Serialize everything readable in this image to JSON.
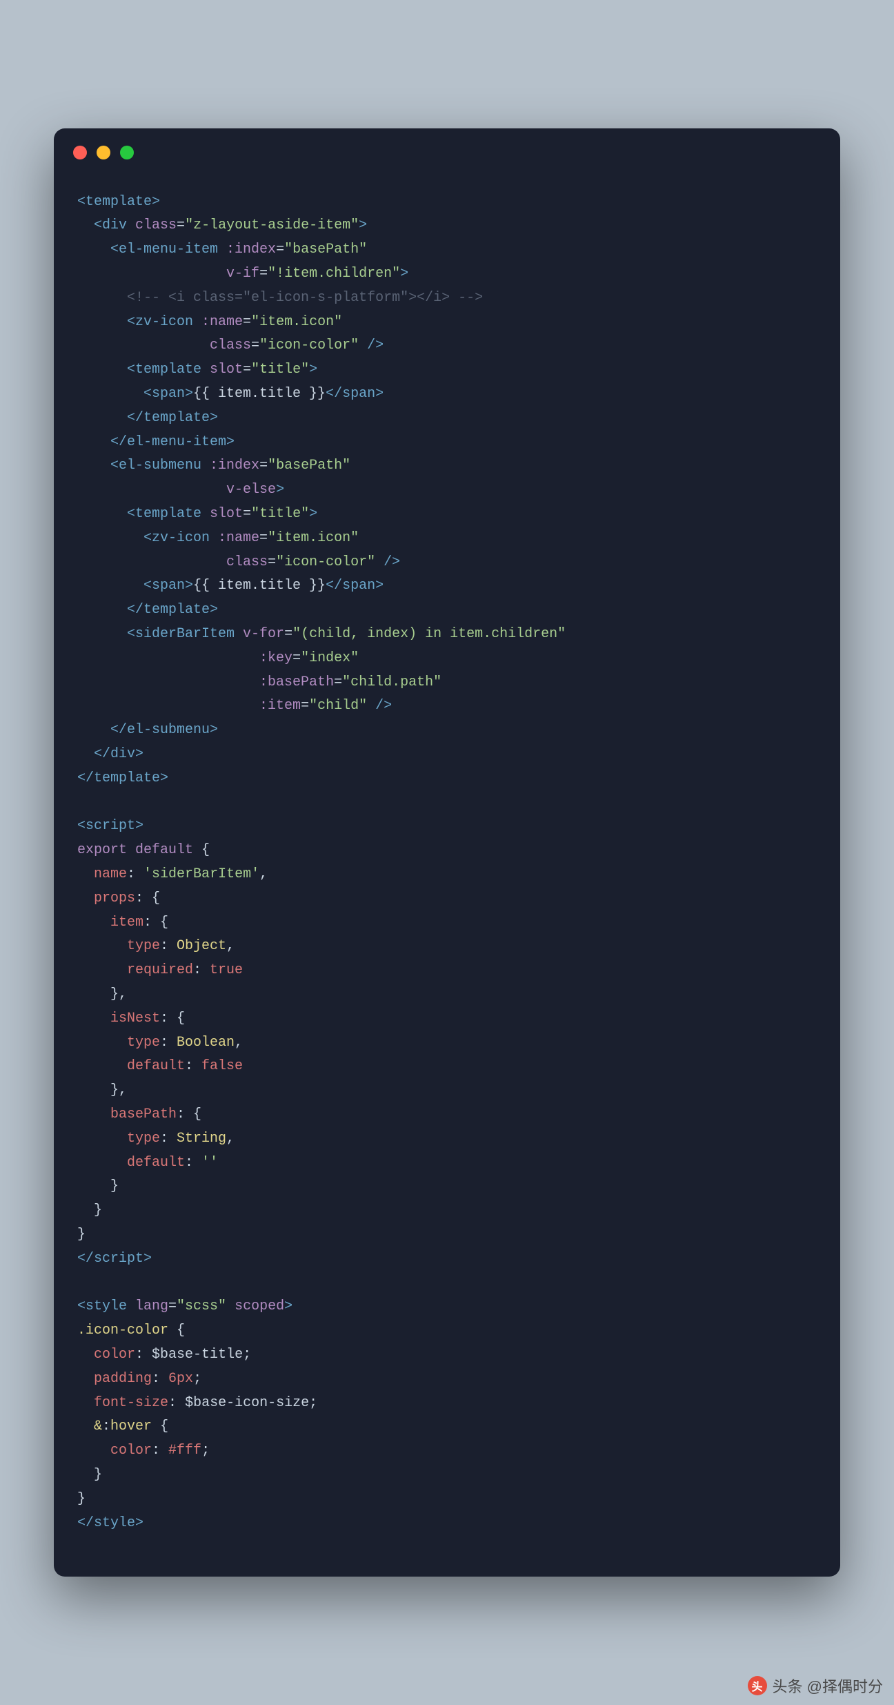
{
  "code": {
    "lines": [
      {
        "indent": 0,
        "tokens": [
          {
            "c": "tag",
            "t": "<template>"
          }
        ]
      },
      {
        "indent": 1,
        "tokens": [
          {
            "c": "tag",
            "t": "<div"
          },
          {
            "c": "attr",
            "t": " class"
          },
          {
            "c": "punct",
            "t": "="
          },
          {
            "c": "str",
            "t": "\"z-layout-aside-item\""
          },
          {
            "c": "tag",
            "t": ">"
          }
        ]
      },
      {
        "indent": 2,
        "tokens": [
          {
            "c": "tag",
            "t": "<el-menu-item"
          },
          {
            "c": "attr",
            "t": " :index"
          },
          {
            "c": "punct",
            "t": "="
          },
          {
            "c": "str",
            "t": "\"basePath\""
          }
        ]
      },
      {
        "indent": 9,
        "tokens": [
          {
            "c": "attr",
            "t": "v-if"
          },
          {
            "c": "punct",
            "t": "="
          },
          {
            "c": "str",
            "t": "\"!item.children\""
          },
          {
            "c": "tag",
            "t": ">"
          }
        ]
      },
      {
        "indent": 3,
        "tokens": [
          {
            "c": "comment",
            "t": "<!-- <i class=\"el-icon-s-platform\"></i> -->"
          }
        ]
      },
      {
        "indent": 3,
        "tokens": [
          {
            "c": "tag",
            "t": "<zv-icon"
          },
          {
            "c": "attr",
            "t": " :name"
          },
          {
            "c": "punct",
            "t": "="
          },
          {
            "c": "str",
            "t": "\"item.icon\""
          }
        ]
      },
      {
        "indent": 7,
        "align": true,
        "tokens": [
          {
            "c": "attr",
            "t": "class"
          },
          {
            "c": "punct",
            "t": "="
          },
          {
            "c": "str",
            "t": "\"icon-color\""
          },
          {
            "c": "tag",
            "t": " />"
          }
        ]
      },
      {
        "indent": 3,
        "tokens": [
          {
            "c": "tag",
            "t": "<template"
          },
          {
            "c": "attr",
            "t": " slot"
          },
          {
            "c": "punct",
            "t": "="
          },
          {
            "c": "str",
            "t": "\"title\""
          },
          {
            "c": "tag",
            "t": ">"
          }
        ]
      },
      {
        "indent": 4,
        "tokens": [
          {
            "c": "tag",
            "t": "<span>"
          },
          {
            "c": "punct",
            "t": "{{ item.title }}"
          },
          {
            "c": "tag",
            "t": "</span>"
          }
        ]
      },
      {
        "indent": 3,
        "tokens": [
          {
            "c": "tag",
            "t": "</template>"
          }
        ]
      },
      {
        "indent": 2,
        "tokens": [
          {
            "c": "tag",
            "t": "</el-menu-item>"
          }
        ]
      },
      {
        "indent": 2,
        "tokens": [
          {
            "c": "tag",
            "t": "<el-submenu"
          },
          {
            "c": "attr",
            "t": " :index"
          },
          {
            "c": "punct",
            "t": "="
          },
          {
            "c": "str",
            "t": "\"basePath\""
          }
        ]
      },
      {
        "indent": 8,
        "align": true,
        "tokens": [
          {
            "c": "attr",
            "t": "v-else"
          },
          {
            "c": "tag",
            "t": ">"
          }
        ]
      },
      {
        "indent": 3,
        "tokens": [
          {
            "c": "tag",
            "t": "<template"
          },
          {
            "c": "attr",
            "t": " slot"
          },
          {
            "c": "punct",
            "t": "="
          },
          {
            "c": "str",
            "t": "\"title\""
          },
          {
            "c": "tag",
            "t": ">"
          }
        ]
      },
      {
        "indent": 4,
        "tokens": [
          {
            "c": "tag",
            "t": "<zv-icon"
          },
          {
            "c": "attr",
            "t": " :name"
          },
          {
            "c": "punct",
            "t": "="
          },
          {
            "c": "str",
            "t": "\"item.icon\""
          }
        ]
      },
      {
        "indent": 8,
        "align": true,
        "tokens": [
          {
            "c": "attr",
            "t": "class"
          },
          {
            "c": "punct",
            "t": "="
          },
          {
            "c": "str",
            "t": "\"icon-color\""
          },
          {
            "c": "tag",
            "t": " />"
          }
        ]
      },
      {
        "indent": 4,
        "tokens": [
          {
            "c": "tag",
            "t": "<span>"
          },
          {
            "c": "punct",
            "t": "{{ item.title }}"
          },
          {
            "c": "tag",
            "t": "</span>"
          }
        ]
      },
      {
        "indent": 3,
        "tokens": [
          {
            "c": "tag",
            "t": "</template>"
          }
        ]
      },
      {
        "indent": 3,
        "tokens": [
          {
            "c": "tag",
            "t": "<siderBarItem"
          },
          {
            "c": "attr",
            "t": " v-for"
          },
          {
            "c": "punct",
            "t": "="
          },
          {
            "c": "str",
            "t": "\"(child, index) in item.children\""
          }
        ]
      },
      {
        "indent": 10,
        "align": true,
        "tokens": [
          {
            "c": "attr",
            "t": ":key"
          },
          {
            "c": "punct",
            "t": "="
          },
          {
            "c": "str",
            "t": "\"index\""
          }
        ]
      },
      {
        "indent": 10,
        "align": true,
        "tokens": [
          {
            "c": "attr",
            "t": ":basePath"
          },
          {
            "c": "punct",
            "t": "="
          },
          {
            "c": "str",
            "t": "\"child.path\""
          }
        ]
      },
      {
        "indent": 10,
        "align": true,
        "tokens": [
          {
            "c": "attr",
            "t": ":item"
          },
          {
            "c": "punct",
            "t": "="
          },
          {
            "c": "str",
            "t": "\"child\""
          },
          {
            "c": "tag",
            "t": " />"
          }
        ]
      },
      {
        "indent": 2,
        "tokens": [
          {
            "c": "tag",
            "t": "</el-submenu>"
          }
        ]
      },
      {
        "indent": 1,
        "tokens": [
          {
            "c": "tag",
            "t": "</div>"
          }
        ]
      },
      {
        "indent": 0,
        "tokens": [
          {
            "c": "tag",
            "t": "</template>"
          }
        ]
      },
      {
        "indent": 0,
        "tokens": []
      },
      {
        "indent": 0,
        "tokens": [
          {
            "c": "tag",
            "t": "<script>"
          }
        ]
      },
      {
        "indent": 0,
        "tokens": [
          {
            "c": "kw",
            "t": "export"
          },
          {
            "c": "punct",
            "t": " "
          },
          {
            "c": "kw",
            "t": "default"
          },
          {
            "c": "punct",
            "t": " {"
          }
        ]
      },
      {
        "indent": 1,
        "tokens": [
          {
            "c": "prop",
            "t": "name"
          },
          {
            "c": "punct",
            "t": ": "
          },
          {
            "c": "val-str",
            "t": "'siderBarItem'"
          },
          {
            "c": "punct",
            "t": ","
          }
        ]
      },
      {
        "indent": 1,
        "tokens": [
          {
            "c": "prop",
            "t": "props"
          },
          {
            "c": "punct",
            "t": ": {"
          }
        ]
      },
      {
        "indent": 2,
        "tokens": [
          {
            "c": "prop",
            "t": "item"
          },
          {
            "c": "punct",
            "t": ": {"
          }
        ]
      },
      {
        "indent": 3,
        "tokens": [
          {
            "c": "prop",
            "t": "type"
          },
          {
            "c": "punct",
            "t": ": "
          },
          {
            "c": "val-obj",
            "t": "Object"
          },
          {
            "c": "punct",
            "t": ","
          }
        ]
      },
      {
        "indent": 3,
        "tokens": [
          {
            "c": "prop",
            "t": "required"
          },
          {
            "c": "punct",
            "t": ": "
          },
          {
            "c": "val-bool",
            "t": "true"
          }
        ]
      },
      {
        "indent": 2,
        "tokens": [
          {
            "c": "punct",
            "t": "},"
          }
        ]
      },
      {
        "indent": 2,
        "tokens": [
          {
            "c": "prop",
            "t": "isNest"
          },
          {
            "c": "punct",
            "t": ": {"
          }
        ]
      },
      {
        "indent": 3,
        "tokens": [
          {
            "c": "prop",
            "t": "type"
          },
          {
            "c": "punct",
            "t": ": "
          },
          {
            "c": "val-obj",
            "t": "Boolean"
          },
          {
            "c": "punct",
            "t": ","
          }
        ]
      },
      {
        "indent": 3,
        "tokens": [
          {
            "c": "prop",
            "t": "default"
          },
          {
            "c": "punct",
            "t": ": "
          },
          {
            "c": "val-bool",
            "t": "false"
          }
        ]
      },
      {
        "indent": 2,
        "tokens": [
          {
            "c": "punct",
            "t": "},"
          }
        ]
      },
      {
        "indent": 2,
        "tokens": [
          {
            "c": "prop",
            "t": "basePath"
          },
          {
            "c": "punct",
            "t": ": {"
          }
        ]
      },
      {
        "indent": 3,
        "tokens": [
          {
            "c": "prop",
            "t": "type"
          },
          {
            "c": "punct",
            "t": ": "
          },
          {
            "c": "val-obj",
            "t": "String"
          },
          {
            "c": "punct",
            "t": ","
          }
        ]
      },
      {
        "indent": 3,
        "tokens": [
          {
            "c": "prop",
            "t": "default"
          },
          {
            "c": "punct",
            "t": ": "
          },
          {
            "c": "val-str",
            "t": "''"
          }
        ]
      },
      {
        "indent": 2,
        "tokens": [
          {
            "c": "punct",
            "t": "}"
          }
        ]
      },
      {
        "indent": 1,
        "tokens": [
          {
            "c": "punct",
            "t": "}"
          }
        ]
      },
      {
        "indent": 0,
        "tokens": [
          {
            "c": "punct",
            "t": "}"
          }
        ]
      },
      {
        "indent": 0,
        "tokens": [
          {
            "c": "tag",
            "t": "</script>"
          }
        ]
      },
      {
        "indent": 0,
        "tokens": []
      },
      {
        "indent": 0,
        "tokens": [
          {
            "c": "tag",
            "t": "<style"
          },
          {
            "c": "attr",
            "t": " lang"
          },
          {
            "c": "punct",
            "t": "="
          },
          {
            "c": "str",
            "t": "\"scss\""
          },
          {
            "c": "attr",
            "t": " scoped"
          },
          {
            "c": "tag",
            "t": ">"
          }
        ]
      },
      {
        "indent": 0,
        "tokens": [
          {
            "c": "css-sel",
            "t": ".icon-color"
          },
          {
            "c": "punct",
            "t": " {"
          }
        ]
      },
      {
        "indent": 1,
        "tokens": [
          {
            "c": "css-prop",
            "t": "color"
          },
          {
            "c": "punct",
            "t": ": "
          },
          {
            "c": "css-val",
            "t": "$base-title"
          },
          {
            "c": "punct",
            "t": ";"
          }
        ]
      },
      {
        "indent": 1,
        "tokens": [
          {
            "c": "css-prop",
            "t": "padding"
          },
          {
            "c": "punct",
            "t": ": "
          },
          {
            "c": "css-var",
            "t": "6px"
          },
          {
            "c": "punct",
            "t": ";"
          }
        ]
      },
      {
        "indent": 1,
        "tokens": [
          {
            "c": "css-prop",
            "t": "font-size"
          },
          {
            "c": "punct",
            "t": ": "
          },
          {
            "c": "css-val",
            "t": "$base-icon-size"
          },
          {
            "c": "punct",
            "t": ";"
          }
        ]
      },
      {
        "indent": 1,
        "tokens": [
          {
            "c": "css-sel",
            "t": "&"
          },
          {
            "c": "punct",
            "t": ":"
          },
          {
            "c": "css-sel",
            "t": "hover"
          },
          {
            "c": "punct",
            "t": " {"
          }
        ]
      },
      {
        "indent": 2,
        "tokens": [
          {
            "c": "css-prop",
            "t": "color"
          },
          {
            "c": "punct",
            "t": ": "
          },
          {
            "c": "css-var",
            "t": "#fff"
          },
          {
            "c": "punct",
            "t": ";"
          }
        ]
      },
      {
        "indent": 1,
        "tokens": [
          {
            "c": "punct",
            "t": "}"
          }
        ]
      },
      {
        "indent": 0,
        "tokens": [
          {
            "c": "punct",
            "t": "}"
          }
        ]
      },
      {
        "indent": 0,
        "tokens": [
          {
            "c": "tag",
            "t": "</style>"
          }
        ]
      }
    ]
  },
  "footer": {
    "text": "头条 @择偶时分"
  }
}
